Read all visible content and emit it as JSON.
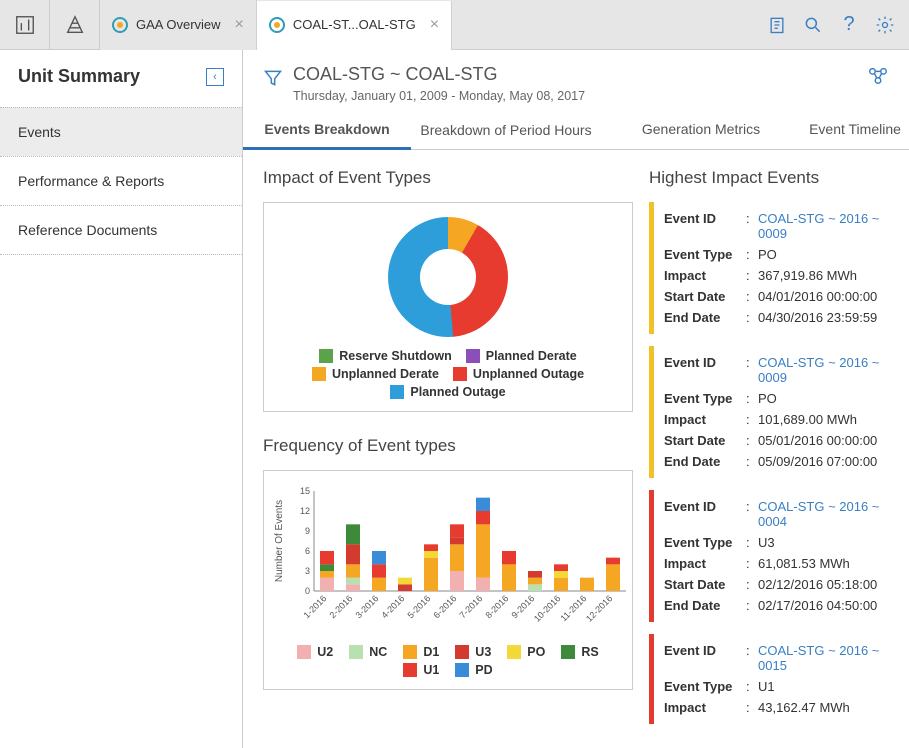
{
  "topTabs": [
    {
      "label": "GAA Overview",
      "active": false
    },
    {
      "label": "COAL-ST...OAL-STG",
      "active": true
    }
  ],
  "sidebar": {
    "title": "Unit Summary",
    "items": [
      {
        "label": "Events",
        "selected": true
      },
      {
        "label": "Performance & Reports",
        "selected": false
      },
      {
        "label": "Reference Documents",
        "selected": false
      }
    ]
  },
  "page": {
    "title": "COAL-STG ~ COAL-STG",
    "subtitle": "Thursday, January 01, 2009 - Monday, May 08, 2017"
  },
  "tabs": [
    "Events Breakdown",
    "Breakdown of Period Hours",
    "Generation Metrics",
    "Event Timeline"
  ],
  "impactSection": {
    "title": "Impact of Event Types",
    "legend": [
      {
        "label": "Reserve Shutdown",
        "color": "#5aa34a"
      },
      {
        "label": "Planned Derate",
        "color": "#8a4fb8"
      },
      {
        "label": "Unplanned Derate",
        "color": "#f5a623"
      },
      {
        "label": "Unplanned Outage",
        "color": "#e63b2e"
      },
      {
        "label": "Planned Outage",
        "color": "#2d9eda"
      }
    ]
  },
  "freqSection": {
    "title": "Frequency of Event types",
    "yLabel": "Number Of Events",
    "yTicks": [
      0,
      3,
      6,
      9,
      12,
      15
    ],
    "categories": [
      "1-2016",
      "2-2016",
      "3-2016",
      "4-2016",
      "5-2016",
      "6-2016",
      "7-2016",
      "8-2016",
      "9-2016",
      "10-2016",
      "11-2016",
      "12-2016"
    ],
    "legend": [
      {
        "label": "U2",
        "color": "#f3b0b0"
      },
      {
        "label": "NC",
        "color": "#b9e0b0"
      },
      {
        "label": "D1",
        "color": "#f5a623"
      },
      {
        "label": "U3",
        "color": "#d23b2e"
      },
      {
        "label": "PO",
        "color": "#f4d837"
      },
      {
        "label": "RS",
        "color": "#3d8a3a"
      },
      {
        "label": "U1",
        "color": "#e63b2e"
      },
      {
        "label": "PD",
        "color": "#3a8bd8"
      }
    ]
  },
  "highImpact": {
    "title": "Highest Impact Events",
    "labels": {
      "eventId": "Event ID",
      "eventType": "Event Type",
      "impact": "Impact",
      "startDate": "Start Date",
      "endDate": "End Date"
    },
    "events": [
      {
        "sev": "y",
        "id": "COAL-STG ~ 2016 ~ 0009",
        "type": "PO",
        "impact": "367,919.86 MWh",
        "start": "04/01/2016 00:00:00",
        "end": "04/30/2016 23:59:59"
      },
      {
        "sev": "y",
        "id": "COAL-STG ~ 2016 ~ 0009",
        "type": "PO",
        "impact": "101,689.00 MWh",
        "start": "05/01/2016 00:00:00",
        "end": "05/09/2016 07:00:00"
      },
      {
        "sev": "r",
        "id": "COAL-STG ~ 2016 ~ 0004",
        "type": "U3",
        "impact": "61,081.53 MWh",
        "start": "02/12/2016 05:18:00",
        "end": "02/17/2016 04:50:00"
      },
      {
        "sev": "r",
        "id": "COAL-STG ~ 2016 ~ 0015",
        "type": "U1",
        "impact": "43,162.47 MWh",
        "start": "",
        "end": ""
      }
    ]
  },
  "chart_data": [
    {
      "type": "pie",
      "title": "Impact of Event Types",
      "series": [
        {
          "name": "Unplanned Derate",
          "value": 8
        },
        {
          "name": "Unplanned Outage",
          "value": 40
        },
        {
          "name": "Planned Outage",
          "value": 52
        },
        {
          "name": "Reserve Shutdown",
          "value": 0
        },
        {
          "name": "Planned Derate",
          "value": 0
        }
      ]
    },
    {
      "type": "bar",
      "title": "Frequency of Event types",
      "xlabel": "",
      "ylabel": "Number Of Events",
      "ylim": [
        0,
        15
      ],
      "categories": [
        "1-2016",
        "2-2016",
        "3-2016",
        "4-2016",
        "5-2016",
        "6-2016",
        "7-2016",
        "8-2016",
        "9-2016",
        "10-2016",
        "11-2016",
        "12-2016"
      ],
      "series": [
        {
          "name": "U2",
          "values": [
            2,
            1,
            0,
            0,
            0,
            3,
            2,
            0,
            0,
            0,
            0,
            0
          ]
        },
        {
          "name": "NC",
          "values": [
            0,
            1,
            0,
            0,
            0,
            0,
            0,
            0,
            1,
            0,
            0,
            0
          ]
        },
        {
          "name": "D1",
          "values": [
            1,
            2,
            2,
            0,
            5,
            4,
            8,
            4,
            1,
            2,
            2,
            4
          ]
        },
        {
          "name": "U3",
          "values": [
            0,
            3,
            0,
            1,
            0,
            1,
            0,
            0,
            1,
            0,
            0,
            0
          ]
        },
        {
          "name": "PO",
          "values": [
            0,
            0,
            0,
            1,
            1,
            0,
            0,
            0,
            0,
            1,
            0,
            0
          ]
        },
        {
          "name": "RS",
          "values": [
            1,
            3,
            0,
            0,
            0,
            0,
            0,
            0,
            0,
            0,
            0,
            0
          ]
        },
        {
          "name": "U1",
          "values": [
            2,
            0,
            2,
            0,
            1,
            2,
            2,
            2,
            0,
            1,
            0,
            1
          ]
        },
        {
          "name": "PD",
          "values": [
            0,
            0,
            2,
            0,
            0,
            0,
            2,
            0,
            0,
            0,
            0,
            0
          ]
        }
      ]
    }
  ]
}
